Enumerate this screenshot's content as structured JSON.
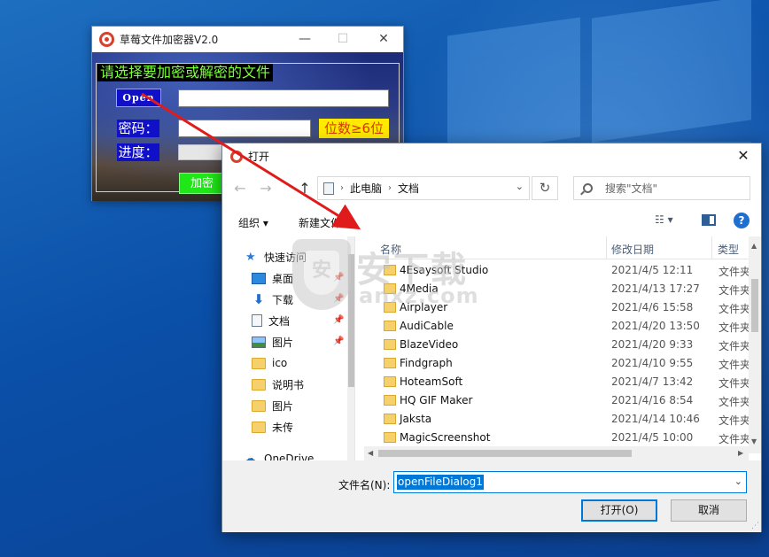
{
  "app": {
    "title": "草莓文件加密器V2.0",
    "minimize": "—",
    "maximize": "☐",
    "close": "✕",
    "heading": "请选择要加密或解密的文件",
    "open_btn": "Open",
    "pwd_label": "密码：",
    "pwd_hint": "位数≥6位",
    "progress_label": "进度：",
    "encrypt_btn": "加密"
  },
  "dialog": {
    "title": "打开",
    "close": "✕",
    "nav": {
      "back": "←",
      "forward": "→",
      "up": "↑"
    },
    "address": {
      "root": "此电脑",
      "folder": "文档",
      "sep": "›",
      "dropdown": "⌄"
    },
    "refresh": "↻",
    "search_placeholder": "搜索\"文档\"",
    "toolbar": {
      "organize": "组织 ▾",
      "new_folder": "新建文件夹",
      "view": "☷ ▾",
      "help": "?"
    },
    "nav_items": [
      {
        "label": "快速访问",
        "icon": "star-icon",
        "pinned": false
      },
      {
        "label": "桌面",
        "icon": "desktop-icon",
        "pinned": true
      },
      {
        "label": "下载",
        "icon": "download-icon",
        "pinned": true
      },
      {
        "label": "文档",
        "icon": "document-icon",
        "pinned": true
      },
      {
        "label": "图片",
        "icon": "picture-icon",
        "pinned": true
      },
      {
        "label": "ico",
        "icon": "folder-icon",
        "pinned": false
      },
      {
        "label": "说明书",
        "icon": "folder-icon",
        "pinned": false
      },
      {
        "label": "图片",
        "icon": "folder-icon",
        "pinned": false
      },
      {
        "label": "未传",
        "icon": "folder-icon",
        "pinned": false
      },
      {
        "label": "OneDrive",
        "icon": "cloud-icon",
        "pinned": false
      }
    ],
    "pin_glyph": "📌",
    "columns": {
      "name": "名称",
      "date": "修改日期",
      "type": "类型"
    },
    "files": [
      {
        "name": "4Esaysoft Studio",
        "date": "2021/4/5 12:11",
        "type": "文件夹"
      },
      {
        "name": "4Media",
        "date": "2021/4/13 17:27",
        "type": "文件夹"
      },
      {
        "name": "Airplayer",
        "date": "2021/4/6 15:58",
        "type": "文件夹"
      },
      {
        "name": "AudiCable",
        "date": "2021/4/20 13:50",
        "type": "文件夹"
      },
      {
        "name": "BlazeVideo",
        "date": "2021/4/20 9:33",
        "type": "文件夹"
      },
      {
        "name": "Findgraph",
        "date": "2021/4/10 9:55",
        "type": "文件夹"
      },
      {
        "name": "HoteamSoft",
        "date": "2021/4/7 13:42",
        "type": "文件夹"
      },
      {
        "name": "HQ GIF Maker",
        "date": "2021/4/16 8:54",
        "type": "文件夹"
      },
      {
        "name": "Jaksta",
        "date": "2021/4/14 10:46",
        "type": "文件夹"
      },
      {
        "name": "MagicScreenshot",
        "date": "2021/4/5 10:00",
        "type": "文件夹"
      }
    ],
    "filename_label": "文件名(N):",
    "filename_value": "openFileDialog1",
    "open_btn": "打开(O)",
    "cancel_btn": "取消"
  },
  "watermark": {
    "cn": "安下载",
    "en": "anxz.com",
    "shield": "安"
  },
  "colors": {
    "accent": "#0078d7",
    "open_btn_bg": "#1010c8",
    "encrypt_btn_bg": "#20e818",
    "hint_bg": "#ffea00",
    "arrow": "#e01b1b"
  }
}
